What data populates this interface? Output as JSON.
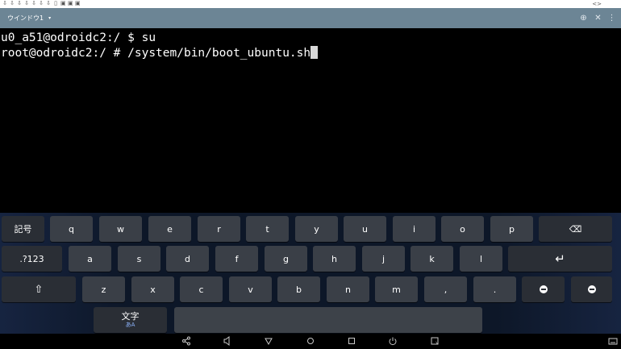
{
  "statusbar": {
    "icons": [
      "download-icon",
      "download-icon",
      "download-icon",
      "download-icon",
      "download-icon",
      "download-icon",
      "download-icon",
      "file-icon",
      "image-icon",
      "image-icon",
      "image-icon"
    ],
    "right_symbol": "<>"
  },
  "toolbar": {
    "window_title": "ウインドウ1",
    "dropdown_glyph": "▾",
    "add_glyph": "⊕",
    "close_glyph": "✕",
    "menu_glyph": "⋮"
  },
  "terminal": {
    "lines": [
      "u0_a51@odroidc2:/ $ su",
      "root@odroidc2:/ # /system/bin/boot_ubuntu.sh"
    ]
  },
  "keyboard": {
    "row1": [
      "記号",
      "q",
      "w",
      "e",
      "r",
      "t",
      "y",
      "u",
      "i",
      "o",
      "p",
      "⌫"
    ],
    "row2": [
      ".?123",
      "a",
      "s",
      "d",
      "f",
      "g",
      "h",
      "j",
      "k",
      "l",
      "↵"
    ],
    "row3": [
      "⇧",
      "z",
      "x",
      "c",
      "v",
      "b",
      "n",
      "m",
      ",",
      "."
    ],
    "row4": {
      "lang_top": "文字",
      "lang_sub": "あA",
      "space": ""
    }
  },
  "navbar": {
    "share": "share-icon",
    "volume": "volume-icon",
    "back": "back-icon",
    "home": "home-icon",
    "recents": "recents-icon",
    "power": "power-icon",
    "screenshot": "screenshot-icon",
    "keyboard": "keyboard-icon"
  }
}
